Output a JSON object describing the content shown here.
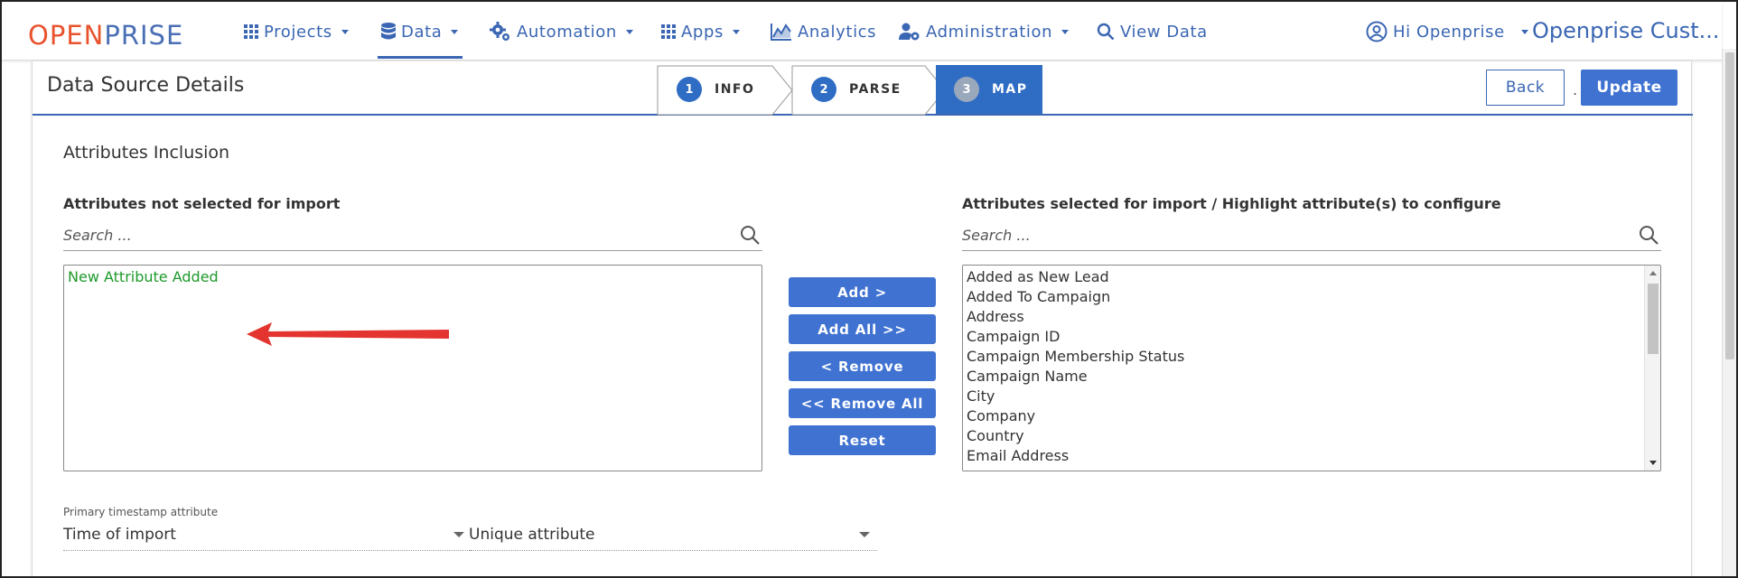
{
  "brand": {
    "logo_part1": "OPEN",
    "logo_part2": "PRISE"
  },
  "nav": {
    "items": [
      {
        "label": "Projects",
        "icon": "grid-icon"
      },
      {
        "label": "Data",
        "icon": "database-icon"
      },
      {
        "label": "Automation",
        "icon": "gears-icon"
      },
      {
        "label": "Apps",
        "icon": "grid-icon"
      },
      {
        "label": "Analytics",
        "icon": "chart-icon"
      },
      {
        "label": "Administration",
        "icon": "user-gear-icon"
      },
      {
        "label": "View Data",
        "icon": "search-icon"
      }
    ],
    "user_greeting": "Hi Openprise",
    "user_name": "Openprise Cust...",
    "active_item": "Data",
    "accent_color": "#3a66b3"
  },
  "page": {
    "title": "Data Source Details",
    "steps": [
      {
        "num": "1",
        "label": "INFO"
      },
      {
        "num": "2",
        "label": "PARSE"
      },
      {
        "num": "3",
        "label": "MAP"
      }
    ],
    "active_step": "MAP",
    "back_label": "Back",
    "update_label": "Update",
    "separator": "."
  },
  "attributes": {
    "section_title": "Attributes Inclusion",
    "left_label": "Attributes not selected for import",
    "right_label": "Attributes selected for import / Highlight attribute(s) to configure",
    "search_placeholder": "Search ...",
    "not_selected": [
      "New Attribute Added"
    ],
    "selected": [
      "Added as New Lead",
      "Added To Campaign",
      "Address",
      "Campaign ID",
      "Campaign Membership Status",
      "Campaign Name",
      "City",
      "Company",
      "Country",
      "Email Address"
    ],
    "buttons": {
      "add": "Add >",
      "add_all": "Add All >>",
      "remove": "< Remove",
      "remove_all": "<< Remove All",
      "reset": "Reset"
    }
  },
  "settings": {
    "primary_timestamp_label": "Primary timestamp attribute",
    "primary_timestamp_value": "Time of import",
    "unique_attribute_placeholder": "Unique attribute"
  }
}
